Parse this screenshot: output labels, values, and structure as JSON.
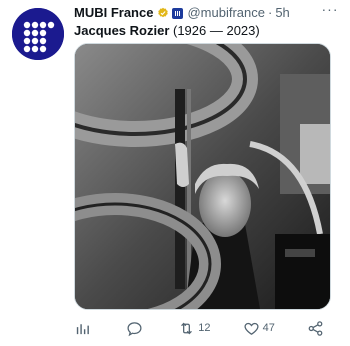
{
  "tweet": {
    "author": {
      "display_name": "MUBI France",
      "handle": "@mubifrance",
      "separator": "·",
      "time": "5h"
    },
    "text": {
      "bold_part": "Jacques Rozier",
      "rest": " (1926 — 2023)"
    },
    "actions": {
      "views_count": "",
      "reply_count": "",
      "retweet_count": "12",
      "like_count": "47"
    },
    "more_label": "···"
  },
  "colors": {
    "avatar_bg": "#1b1a8f",
    "verified_gold": "#e2b719",
    "muted": "#536471"
  },
  "icons": [
    "mubi-logo-icon",
    "verified-badge-icon",
    "affiliate-badge-icon",
    "more-icon",
    "views-icon",
    "reply-icon",
    "retweet-icon",
    "like-icon",
    "share-icon"
  ]
}
